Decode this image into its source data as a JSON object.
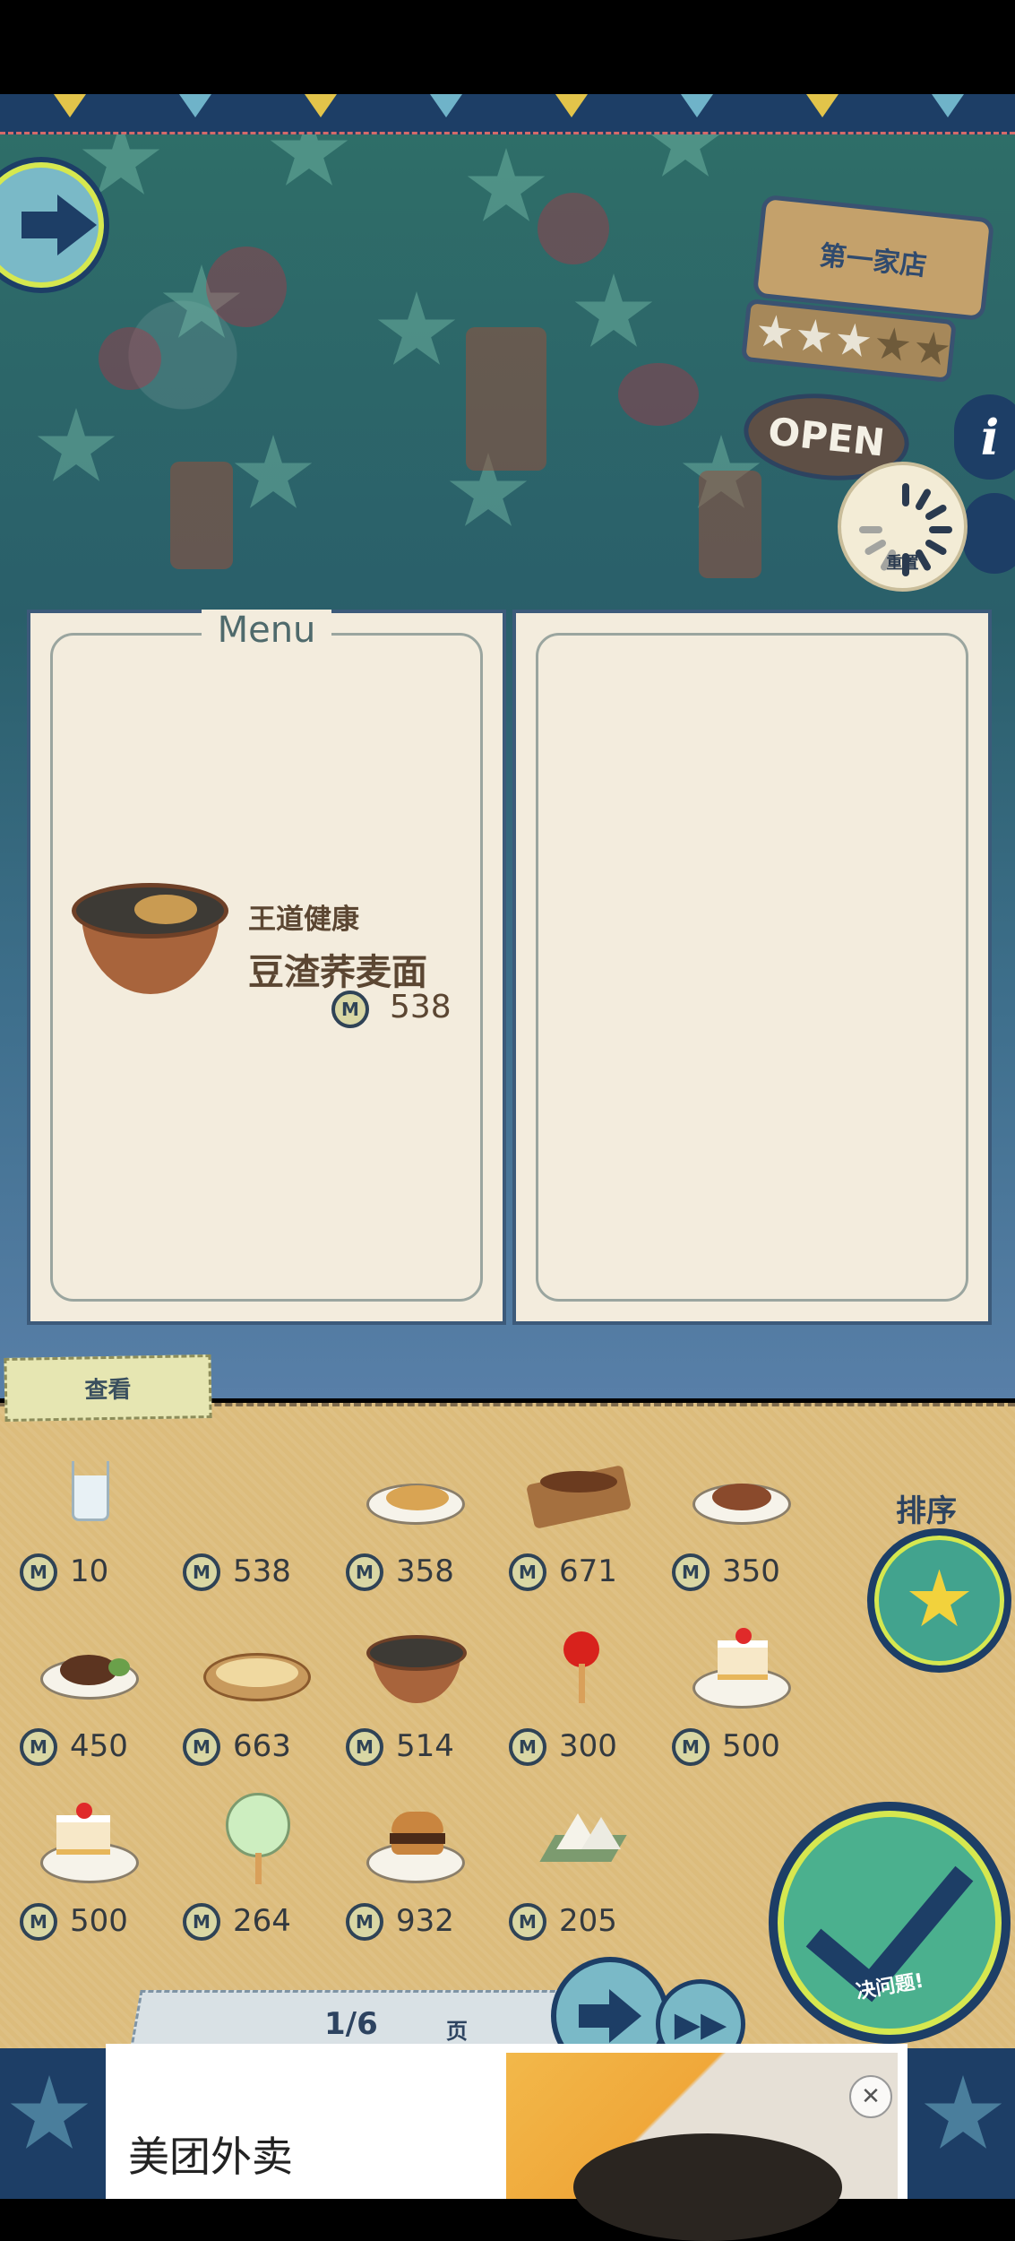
{
  "scene": {
    "shop_sign": "第一家店",
    "open_sign": "OPEN",
    "rating_stars": 3,
    "rating_max": 5,
    "reset_label": "重置"
  },
  "menu": {
    "title": "Menu",
    "featured": {
      "tag": "王道健康",
      "name": "豆渣荞麦面",
      "price": "538",
      "icon": "noodle-bowl-icon"
    }
  },
  "panel": {
    "view_tab": "查看",
    "sort_label": "排序",
    "decide_label": "决问题!",
    "coin_letter": "M",
    "page_indicator": "1/6",
    "page_unit": "页",
    "items": [
      {
        "icon": "water-glass-icon",
        "price": "10"
      },
      {
        "icon": "empty-icon",
        "price": "538"
      },
      {
        "icon": "gyoza-icon",
        "price": "358"
      },
      {
        "icon": "yakitori-icon",
        "price": "671"
      },
      {
        "icon": "mapo-tofu-icon",
        "price": "350"
      },
      {
        "icon": "hamburg-steak-icon",
        "price": "450"
      },
      {
        "icon": "gratin-icon",
        "price": "663"
      },
      {
        "icon": "noodle-bowl-icon",
        "price": "514"
      },
      {
        "icon": "candy-apple-icon",
        "price": "300"
      },
      {
        "icon": "shortcake-icon",
        "price": "500"
      },
      {
        "icon": "shortcake-icon",
        "price": "500"
      },
      {
        "icon": "cotton-candy-icon",
        "price": "264"
      },
      {
        "icon": "hamburger-icon",
        "price": "932"
      },
      {
        "icon": "onigiri-icon",
        "price": "205"
      }
    ]
  },
  "ad": {
    "title": "美团外卖",
    "close": "✕"
  },
  "colors": {
    "navy": "#1d3e66",
    "panel": "#dcbc7c",
    "paper": "#f3ecdd",
    "accent_green": "#4bb08e",
    "accent_yellow": "#d6e84f"
  }
}
